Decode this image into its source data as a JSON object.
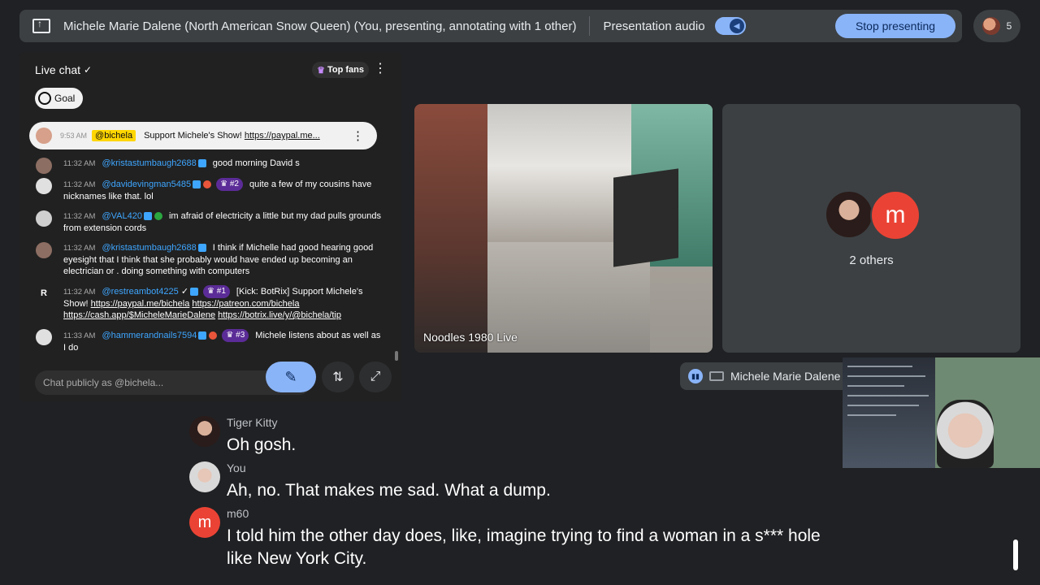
{
  "topbar": {
    "title": "Michele Marie Dalene (North American Snow Queen) (You, presenting, annotating with 1 other)",
    "presentation_audio": "Presentation audio",
    "stop_presenting": "Stop presenting",
    "participant_count": "5"
  },
  "chat": {
    "title": "Live chat",
    "top_fans": "Top fans",
    "goal": "Goal",
    "pinned": {
      "time": "9:53 AM",
      "handle": "@bichela",
      "text": "Support Michele's Show!",
      "link": "https://paypal.me..."
    },
    "messages": [
      {
        "time": "11:32 AM",
        "author": "@kristastumbaugh2688",
        "text": "good morning David s"
      },
      {
        "time": "11:32 AM",
        "author": "@davidevingman5485",
        "rank": "#2",
        "text": "quite a few of my cousins have nicknames like that. lol"
      },
      {
        "time": "11:32 AM",
        "author": "@VAL420",
        "text": "im afraid of electricity a little but my dad pulls grounds from extension cords"
      },
      {
        "time": "11:32 AM",
        "author": "@kristastumbaugh2688",
        "text": "I think if Michelle had good hearing good eyesight that I think that she probably would have ended up becoming an electrician or . doing something with computers"
      },
      {
        "time": "11:32 AM",
        "author": "@restreambot4225",
        "rank": "#1",
        "text": "[Kick: BotRix] Support Michele's Show!",
        "links": [
          "https://paypal.me/bichela",
          "https://patreon.com/bichela",
          "https://cash.app/$MicheleMarieDalene",
          "https://botrix.live/y/@bichela/tip"
        ]
      },
      {
        "time": "11:33 AM",
        "author": "@hammerandnails7594",
        "rank": "#3",
        "text": "Michele listens about as well as I do"
      }
    ],
    "input_placeholder": "Chat publicly as @bichela..."
  },
  "tiles": {
    "video_label": "Noodles 1980 Live",
    "others_initial": "m",
    "others_label": "2 others",
    "self_name": "Michele Marie Dalene"
  },
  "captions": [
    {
      "speaker": "Tiger Kitty",
      "text": "Oh gosh."
    },
    {
      "speaker": "You",
      "text": "Ah, no. That makes me sad. What a dump."
    },
    {
      "speaker": "m60",
      "initial": "m",
      "text": "I told him the other day does, like, imagine trying to find a woman in a s*** hole like New York City."
    }
  ],
  "colors": {
    "accent": "#8ab4f8",
    "background": "#202124",
    "chat_link": "#3ea6ff",
    "m60_avatar": "#ea4335"
  }
}
